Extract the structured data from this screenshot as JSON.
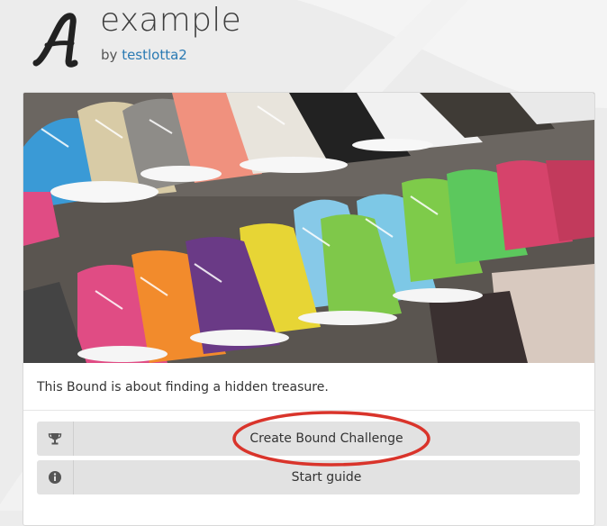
{
  "header": {
    "title": "example",
    "byline_prefix": "by",
    "author": "testlotta2"
  },
  "card": {
    "image_alt": "Rows of colorful high-top sneakers on display shelves",
    "description": "This Bound is about finding a hidden treasure."
  },
  "actions": [
    {
      "label": "Create Bound Challenge",
      "icon": "trophy-icon"
    },
    {
      "label": "Start guide",
      "icon": "info-icon"
    }
  ],
  "colors": {
    "link": "#2a7ab3",
    "button_bg": "#e2e2e2",
    "highlight_ring": "#d9342b",
    "page_bg": "#ececec"
  }
}
